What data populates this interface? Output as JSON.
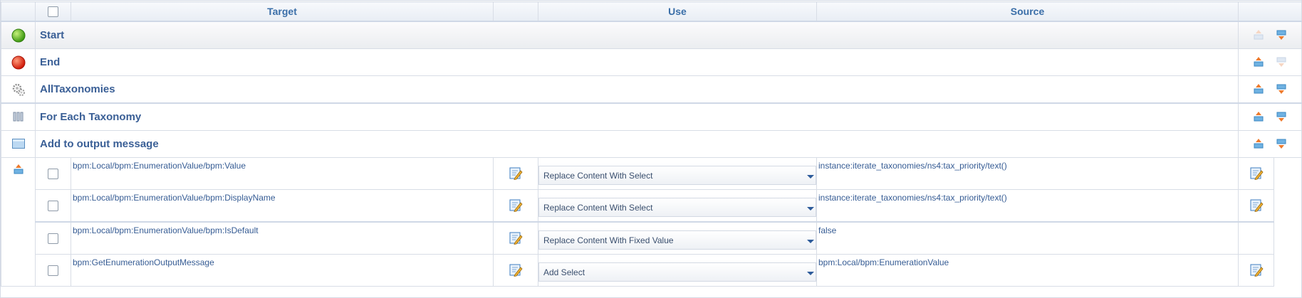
{
  "header": {
    "target": "Target",
    "use": "Use",
    "source": "Source"
  },
  "sections": [
    {
      "name": "Start",
      "icon": "start-green-icon",
      "color": "#5fb42c"
    },
    {
      "name": "End",
      "icon": "end-red-icon",
      "color": "#e0301e"
    },
    {
      "name": "AllTaxonomies",
      "icon": "gears-icon"
    },
    {
      "name": "For Each Taxonomy",
      "icon": "loop-bars-icon"
    },
    {
      "name": "Add to output message",
      "icon": "window-icon"
    }
  ],
  "mappings": [
    {
      "target": "bpm:Local/bpm:EnumerationValue/bpm:Value",
      "use": "Replace Content With Select",
      "source": "instance:iterate_taxonomies/ns4:tax_priority/text()",
      "source_editable": true
    },
    {
      "target": "bpm:Local/bpm:EnumerationValue/bpm:DisplayName",
      "use": "Replace Content With Select",
      "source": "instance:iterate_taxonomies/ns4:tax_priority/text()",
      "source_editable": true
    },
    {
      "target": "bpm:Local/bpm:EnumerationValue/bpm:IsDefault",
      "use": "Replace Content With Fixed Value",
      "source": "false",
      "source_editable": false
    },
    {
      "target": "bpm:GetEnumerationOutputMessage",
      "use": "Add Select",
      "source": "bpm:Local/bpm:EnumerationValue",
      "source_editable": true
    }
  ],
  "colors": {
    "header_text": "#3a6ea8",
    "section_text": "#3a5f96",
    "border": "#d8dde6"
  }
}
